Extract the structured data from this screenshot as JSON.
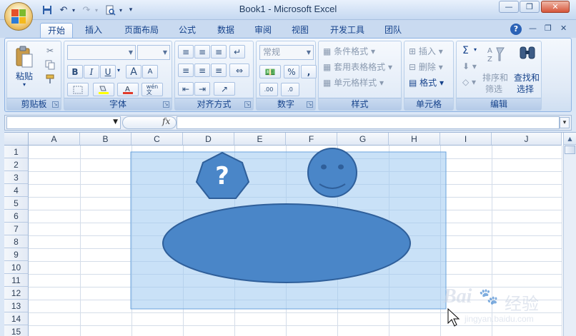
{
  "window": {
    "title": "Book1 - Microsoft Excel",
    "minimize_glyph": "—",
    "maximize_glyph": "❐",
    "close_glyph": "✕"
  },
  "quick_access": {
    "customize_glyph": "▾"
  },
  "tabs": [
    {
      "label": "开始"
    },
    {
      "label": "插入"
    },
    {
      "label": "页面布局"
    },
    {
      "label": "公式"
    },
    {
      "label": "数据"
    },
    {
      "label": "审阅"
    },
    {
      "label": "视图"
    },
    {
      "label": "开发工具"
    },
    {
      "label": "团队"
    }
  ],
  "tabs_right": {
    "help": "?",
    "min": "—",
    "restore": "❐",
    "close": "✕"
  },
  "ribbon": {
    "clipboard": {
      "label": "剪贴板",
      "paste": "粘贴"
    },
    "font": {
      "label": "字体",
      "bold": "B",
      "italic": "I",
      "underline": "U",
      "grow": "A",
      "shrink": "A",
      "wen": "wén\n文"
    },
    "alignment": {
      "label": "对齐方式"
    },
    "number": {
      "label": "数字",
      "format_value": "常规",
      "percent": "%",
      "comma": ","
    },
    "styles": {
      "label": "样式",
      "conditional": "条件格式",
      "table": "套用表格格式",
      "cell_styles": "单元格样式"
    },
    "cells": {
      "label": "单元格",
      "insert": "插入",
      "delete": "删除",
      "format": "格式"
    },
    "editing": {
      "label": "编辑",
      "sum": "Σ",
      "sort_line1": "排序和",
      "sort_line2": "筛选",
      "find_line1": "查找和",
      "find_line2": "选择"
    }
  },
  "formula_bar": {
    "fx": "fx"
  },
  "columns": [
    "A",
    "B",
    "C",
    "D",
    "E",
    "F",
    "G",
    "H",
    "I",
    "J"
  ],
  "rows": [
    "1",
    "2",
    "3",
    "4",
    "5",
    "6",
    "7",
    "8",
    "9",
    "10",
    "11",
    "12",
    "13",
    "14",
    "15"
  ],
  "shapes": {
    "heptagon_text": "?",
    "shape_fill": "#4a86c8",
    "shape_stroke": "#2f5f9a",
    "selection_fill": "#9cc8f0"
  },
  "watermark": {
    "brand": "Bai",
    "brand_cn": "经验",
    "url": "jingyan.baidu.com"
  }
}
